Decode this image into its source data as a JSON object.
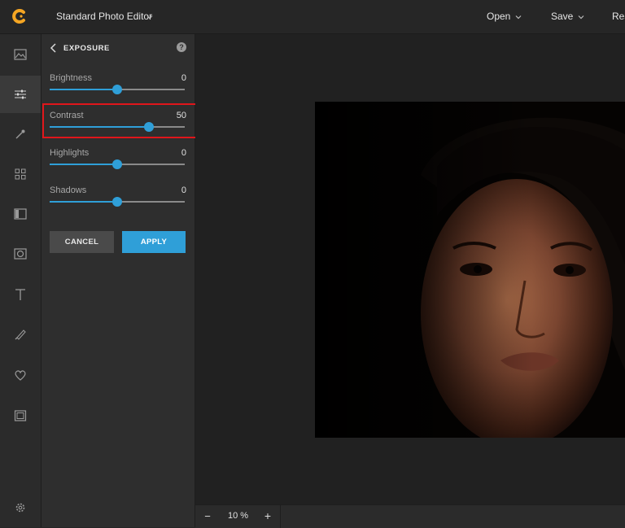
{
  "header": {
    "logo": "app-logo",
    "app_title": "Standard Photo Editor",
    "menu": [
      {
        "label": "Open"
      },
      {
        "label": "Save"
      },
      {
        "label": "Res"
      }
    ]
  },
  "toolbar_icons": [
    "image-icon",
    "sliders-icon",
    "magic-wand-icon",
    "grid-icon",
    "frame-split-icon",
    "vignette-icon",
    "text-icon",
    "brush-icon",
    "heart-icon",
    "border-icon",
    "settings-icon"
  ],
  "panel": {
    "title": "EXPOSURE",
    "sliders": [
      {
        "label": "Brightness",
        "value": "0",
        "fraction": 0.5
      },
      {
        "label": "Contrast",
        "value": "50",
        "fraction": 0.735
      },
      {
        "label": "Highlights",
        "value": "0",
        "fraction": 0.5
      },
      {
        "label": "Shadows",
        "value": "0",
        "fraction": 0.5
      }
    ],
    "cancel_label": "CANCEL",
    "apply_label": "APPLY"
  },
  "zoom": {
    "minus": "−",
    "value": "10 %",
    "plus": "+"
  },
  "colors": {
    "accent": "#2f9fd8",
    "highlight": "#e0161b",
    "logo": "#f5a623"
  }
}
